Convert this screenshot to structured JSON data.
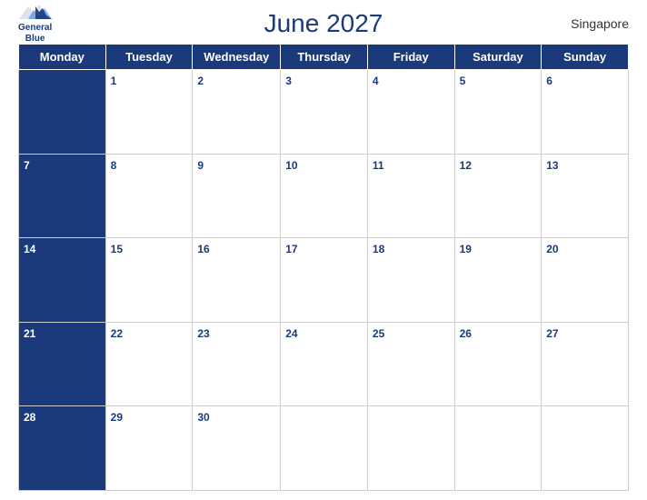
{
  "header": {
    "title": "June 2027",
    "country": "Singapore",
    "logo": {
      "line1": "General",
      "line2": "Blue"
    }
  },
  "weekdays": [
    "Monday",
    "Tuesday",
    "Wednesday",
    "Thursday",
    "Friday",
    "Saturday",
    "Sunday"
  ],
  "weeks": [
    [
      {
        "day": "",
        "blue": true
      },
      {
        "day": "1",
        "blue": false
      },
      {
        "day": "2",
        "blue": false
      },
      {
        "day": "3",
        "blue": false
      },
      {
        "day": "4",
        "blue": false
      },
      {
        "day": "5",
        "blue": false
      },
      {
        "day": "6",
        "blue": false
      }
    ],
    [
      {
        "day": "7",
        "blue": true
      },
      {
        "day": "8",
        "blue": false
      },
      {
        "day": "9",
        "blue": false
      },
      {
        "day": "10",
        "blue": false
      },
      {
        "day": "11",
        "blue": false
      },
      {
        "day": "12",
        "blue": false
      },
      {
        "day": "13",
        "blue": false
      }
    ],
    [
      {
        "day": "14",
        "blue": true
      },
      {
        "day": "15",
        "blue": false
      },
      {
        "day": "16",
        "blue": false
      },
      {
        "day": "17",
        "blue": false
      },
      {
        "day": "18",
        "blue": false
      },
      {
        "day": "19",
        "blue": false
      },
      {
        "day": "20",
        "blue": false
      }
    ],
    [
      {
        "day": "21",
        "blue": true
      },
      {
        "day": "22",
        "blue": false
      },
      {
        "day": "23",
        "blue": false
      },
      {
        "day": "24",
        "blue": false
      },
      {
        "day": "25",
        "blue": false
      },
      {
        "day": "26",
        "blue": false
      },
      {
        "day": "27",
        "blue": false
      }
    ],
    [
      {
        "day": "28",
        "blue": true
      },
      {
        "day": "29",
        "blue": false
      },
      {
        "day": "30",
        "blue": false
      },
      {
        "day": "",
        "blue": false
      },
      {
        "day": "",
        "blue": false
      },
      {
        "day": "",
        "blue": false
      },
      {
        "day": "",
        "blue": false
      }
    ]
  ]
}
